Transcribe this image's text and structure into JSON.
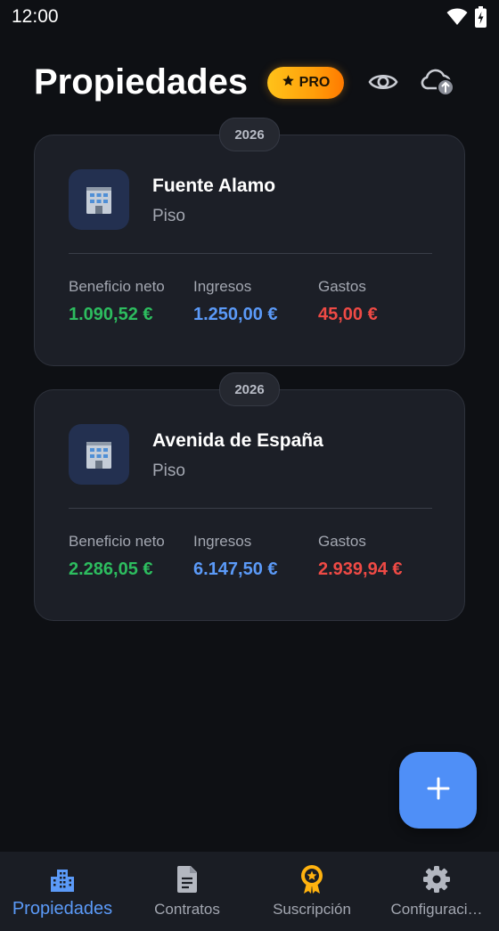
{
  "status_bar": {
    "time": "12:00"
  },
  "header": {
    "title": "Propiedades",
    "pro_label": "PRO"
  },
  "colors": {
    "profit": "#2dbd5f",
    "income": "#5b9af8",
    "expense": "#ef4a45",
    "accent": "#4f8ff7",
    "pro": "#ffb20f"
  },
  "properties": [
    {
      "year": "2026",
      "name": "Fuente Alamo",
      "type": "Piso",
      "icon": "office-building-icon",
      "stats": {
        "net_profit": {
          "label": "Beneficio neto",
          "value": "1.090,52 €"
        },
        "income": {
          "label": "Ingresos",
          "value": "1.250,00 €"
        },
        "expenses": {
          "label": "Gastos",
          "value": "45,00 €"
        }
      }
    },
    {
      "year": "2026",
      "name": "Avenida de España",
      "type": "Piso",
      "icon": "office-building-icon",
      "stats": {
        "net_profit": {
          "label": "Beneficio neto",
          "value": "2.286,05 €"
        },
        "income": {
          "label": "Ingresos",
          "value": "6.147,50 €"
        },
        "expenses": {
          "label": "Gastos",
          "value": "2.939,94 €"
        }
      }
    }
  ],
  "fab": {
    "icon": "plus-icon"
  },
  "bottom_nav": {
    "active_index": 0,
    "items": [
      {
        "label": "Propiedades",
        "icon": "buildings-icon"
      },
      {
        "label": "Contratos",
        "icon": "document-icon"
      },
      {
        "label": "Suscripción",
        "icon": "award-badge-icon"
      },
      {
        "label": "Configuraci…",
        "icon": "gear-icon"
      }
    ]
  }
}
